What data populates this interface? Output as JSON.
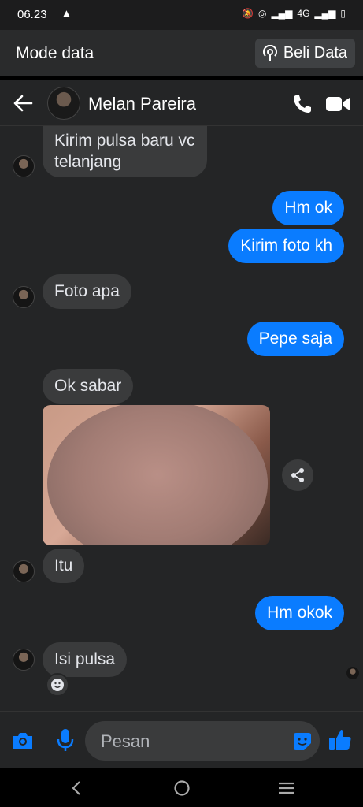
{
  "status_bar": {
    "time": "06.23",
    "network": "4G"
  },
  "data_bar": {
    "mode_label": "Mode data",
    "buy_label": "Beli Data"
  },
  "header": {
    "contact_name": "Melan Pareira"
  },
  "messages": [
    {
      "dir": "in",
      "lines": [
        "Kirim pulsa baru vc",
        "telanjang"
      ]
    },
    {
      "dir": "out",
      "text": "Hm ok"
    },
    {
      "dir": "out",
      "text": "Kirim foto kh"
    },
    {
      "dir": "in",
      "text": "Foto apa"
    },
    {
      "dir": "out",
      "text": "Pepe saja"
    },
    {
      "dir": "in",
      "text": "Ok sabar"
    },
    {
      "dir": "in",
      "text": "Itu"
    },
    {
      "dir": "out",
      "text": "Hm okok"
    },
    {
      "dir": "in",
      "text": "Isi pulsa"
    }
  ],
  "composer": {
    "placeholder": "Pesan"
  },
  "colors": {
    "outgoing": "#0a7cff",
    "incoming": "#3a3b3c",
    "background": "#242526",
    "accent": "#0a7cff"
  }
}
